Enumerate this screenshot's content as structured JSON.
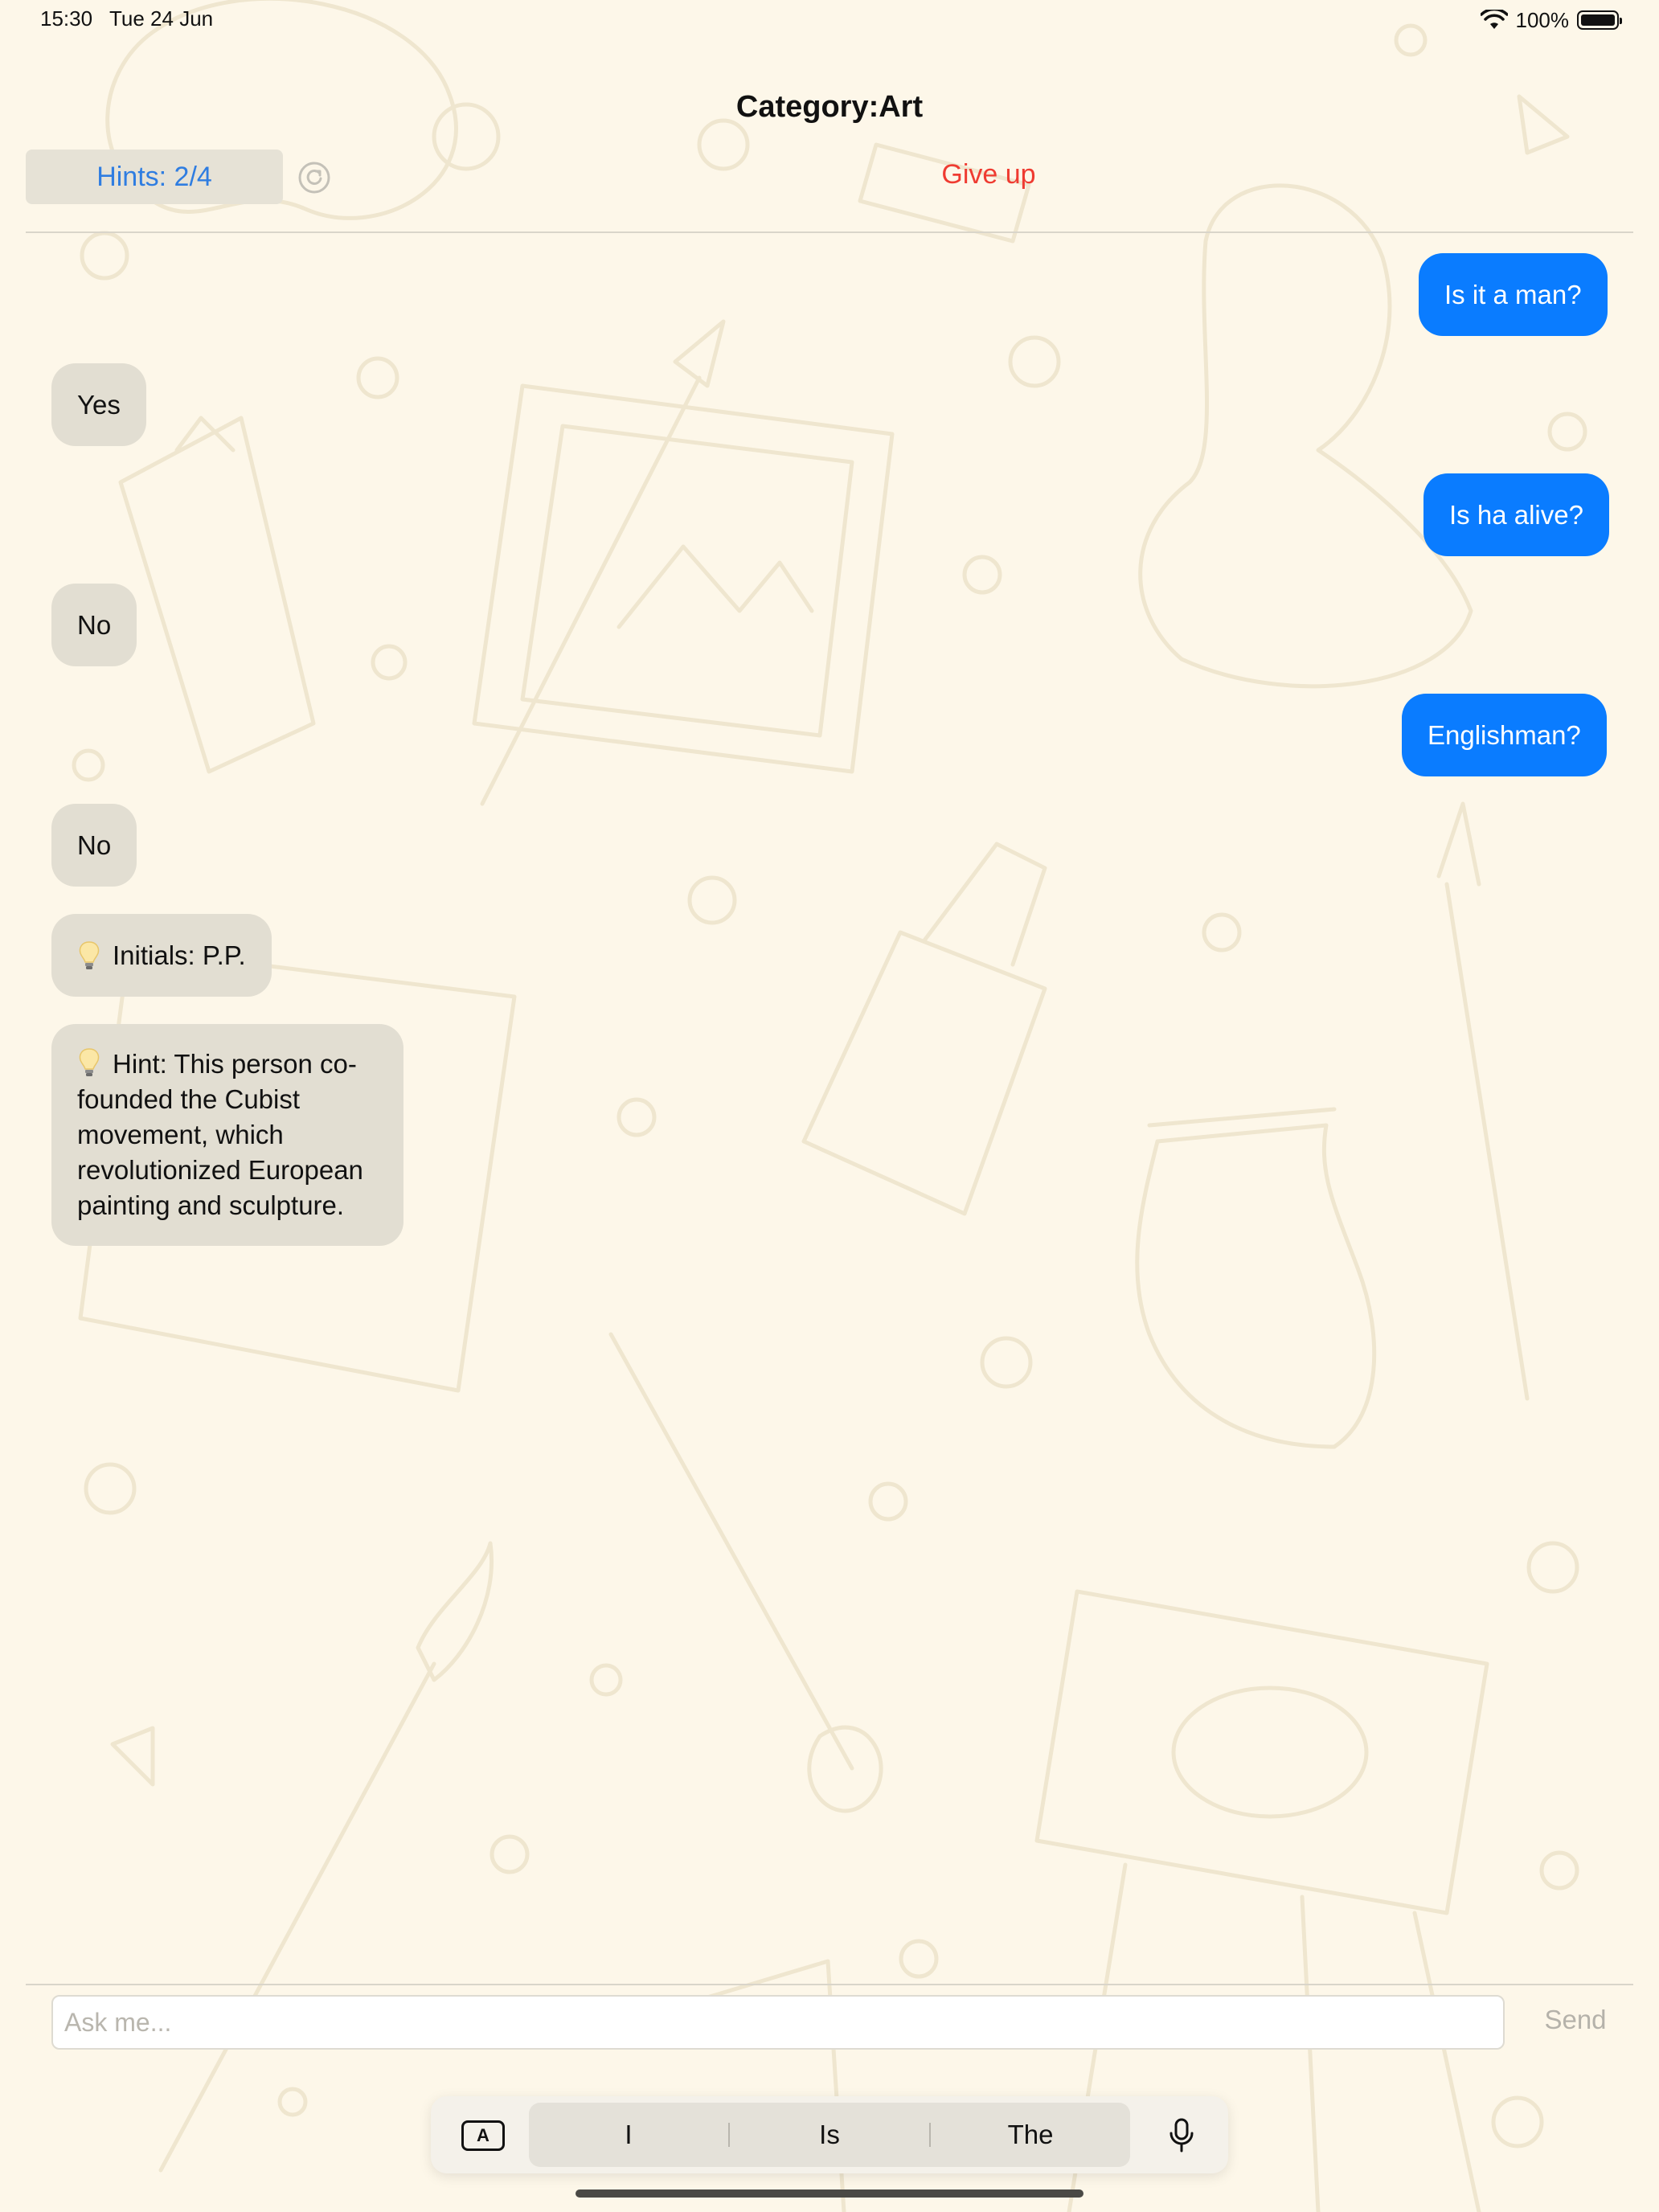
{
  "status_bar": {
    "time": "15:30",
    "date": "Tue 24 Jun",
    "battery": "100%",
    "icons": [
      "wifi-icon",
      "battery-icon"
    ]
  },
  "header": {
    "title": "Category:Art",
    "hints_label": "Hints: 2/4",
    "refresh_icon": "refresh-icon",
    "give_up_label": "Give up"
  },
  "messages": [
    {
      "side": "out",
      "text": "Is it a man?"
    },
    {
      "side": "in",
      "text": "Yes"
    },
    {
      "side": "out",
      "text": "Is ha alive?"
    },
    {
      "side": "in",
      "text": "No"
    },
    {
      "side": "out",
      "text": "Englishman?"
    },
    {
      "side": "in",
      "text": "No"
    },
    {
      "side": "in",
      "icon": "lightbulb-icon",
      "text": "Initials: P.P."
    },
    {
      "side": "in",
      "icon": "lightbulb-icon",
      "text": "Hint: This person co-founded the Cubist movement, which revolutionized European painting and sculpture."
    }
  ],
  "composer": {
    "placeholder": "Ask me...",
    "value": "",
    "send_label": "Send"
  },
  "keyboard_bar": {
    "suggestions": [
      "I",
      "Is",
      "The"
    ],
    "toggle_label": "A",
    "icons": [
      "keyboard-toggle-icon",
      "microphone-icon"
    ]
  },
  "colors": {
    "background": "#fdf7e9",
    "outgoing_bubble": "#0a7cff",
    "incoming_bubble": "#e2ded2",
    "hints_text": "#2f7de1",
    "give_up": "#ef3b31",
    "send_disabled": "#b5b2aa"
  }
}
